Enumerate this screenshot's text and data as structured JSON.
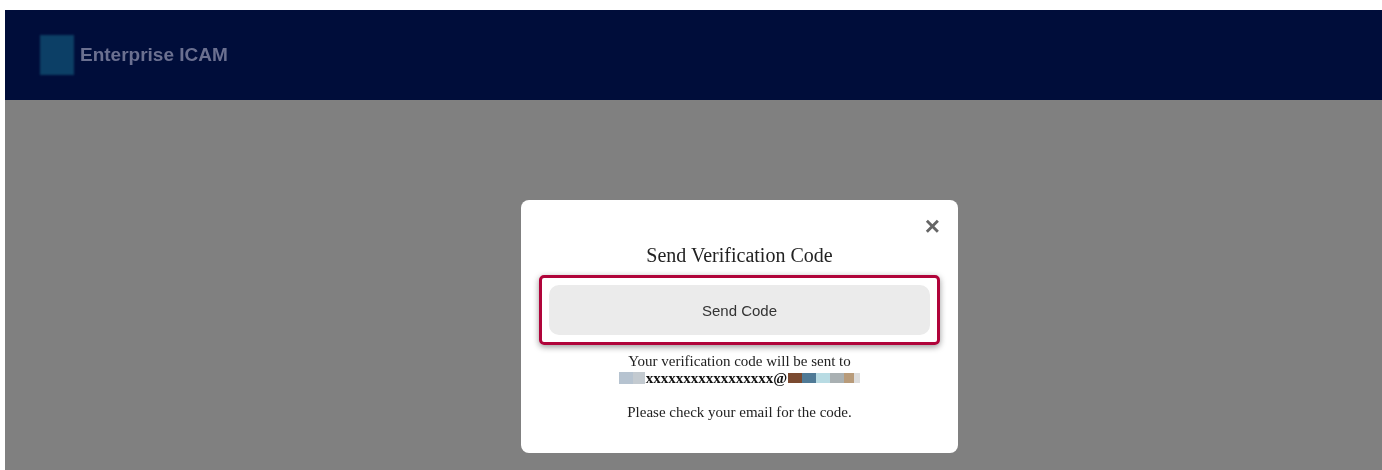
{
  "header": {
    "logo_text": "Enterprise ICAM"
  },
  "dialog": {
    "close": "×",
    "title": "Send Verification Code",
    "button": {
      "label": "Send Code",
      "highlighted": true
    },
    "message": "Your verification code will be sent to",
    "email": "xxxxxxxxxxxxxxxxx@",
    "note": "Please check your email for the code."
  }
}
